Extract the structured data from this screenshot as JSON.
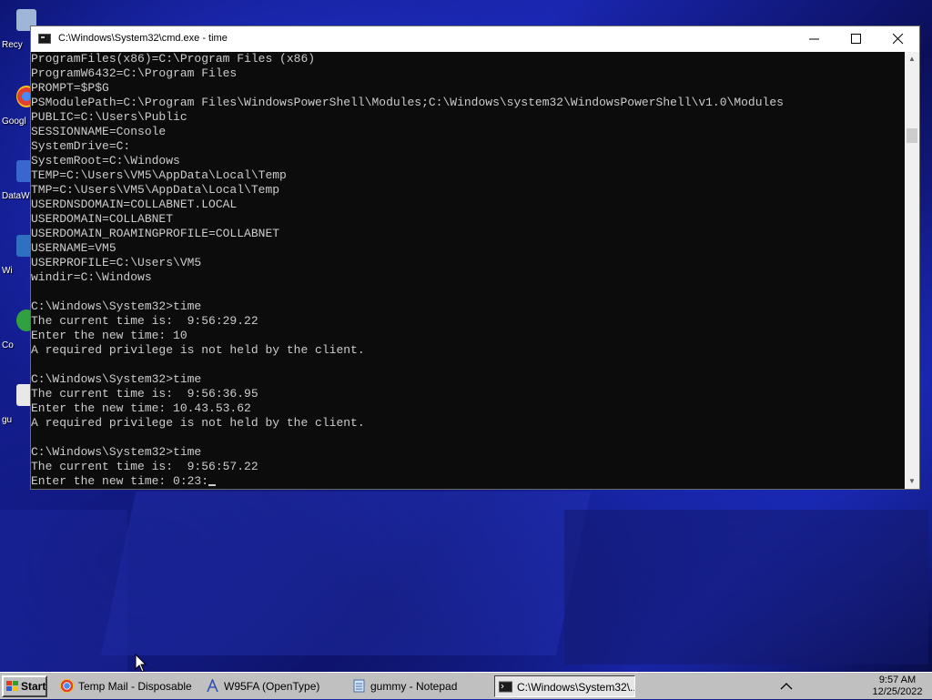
{
  "desktop": {
    "icons": [
      {
        "label": "Recy",
        "icon": "recycle-bin-icon",
        "color": "#9fb6d6"
      },
      {
        "label": "Googl",
        "icon": "chrome-icon",
        "color": "#e04030"
      },
      {
        "label": "DataW",
        "icon": "data-icon",
        "color": "#3a66d0"
      },
      {
        "label": "Wi",
        "icon": "app-icon",
        "color": "#3070c0"
      },
      {
        "label": "Co",
        "icon": "app-icon",
        "color": "#30a040"
      },
      {
        "label": "gu",
        "icon": "file-icon",
        "color": "#e8e8e8"
      }
    ]
  },
  "window": {
    "title": "C:\\Windows\\System32\\cmd.exe - time",
    "console_lines": [
      "ProgramFiles(x86)=C:\\Program Files (x86)",
      "ProgramW6432=C:\\Program Files",
      "PROMPT=$P$G",
      "PSModulePath=C:\\Program Files\\WindowsPowerShell\\Modules;C:\\Windows\\system32\\WindowsPowerShell\\v1.0\\Modules",
      "PUBLIC=C:\\Users\\Public",
      "SESSIONNAME=Console",
      "SystemDrive=C:",
      "SystemRoot=C:\\Windows",
      "TEMP=C:\\Users\\VM5\\AppData\\Local\\Temp",
      "TMP=C:\\Users\\VM5\\AppData\\Local\\Temp",
      "USERDNSDOMAIN=COLLABNET.LOCAL",
      "USERDOMAIN=COLLABNET",
      "USERDOMAIN_ROAMINGPROFILE=COLLABNET",
      "USERNAME=VM5",
      "USERPROFILE=C:\\Users\\VM5",
      "windir=C:\\Windows",
      "",
      "C:\\Windows\\System32>time",
      "The current time is:  9:56:29.22",
      "Enter the new time: 10",
      "A required privilege is not held by the client.",
      "",
      "C:\\Windows\\System32>time",
      "The current time is:  9:56:36.95",
      "Enter the new time: 10.43.53.62",
      "A required privilege is not held by the client.",
      "",
      "C:\\Windows\\System32>time",
      "The current time is:  9:56:57.22",
      "Enter the new time: 0:23:"
    ]
  },
  "taskbar": {
    "start_label": "Start",
    "tasks": [
      {
        "label": "Temp Mail - Disposable ...",
        "icon": "chrome-icon"
      },
      {
        "label": "W95FA (OpenType)",
        "icon": "font-icon"
      },
      {
        "label": "gummy - Notepad",
        "icon": "notepad-icon"
      },
      {
        "label": "C:\\Windows\\System32\\...",
        "icon": "cmd-icon",
        "active": true
      }
    ],
    "clock_time": "9:57 AM",
    "clock_date": "12/25/2022"
  }
}
